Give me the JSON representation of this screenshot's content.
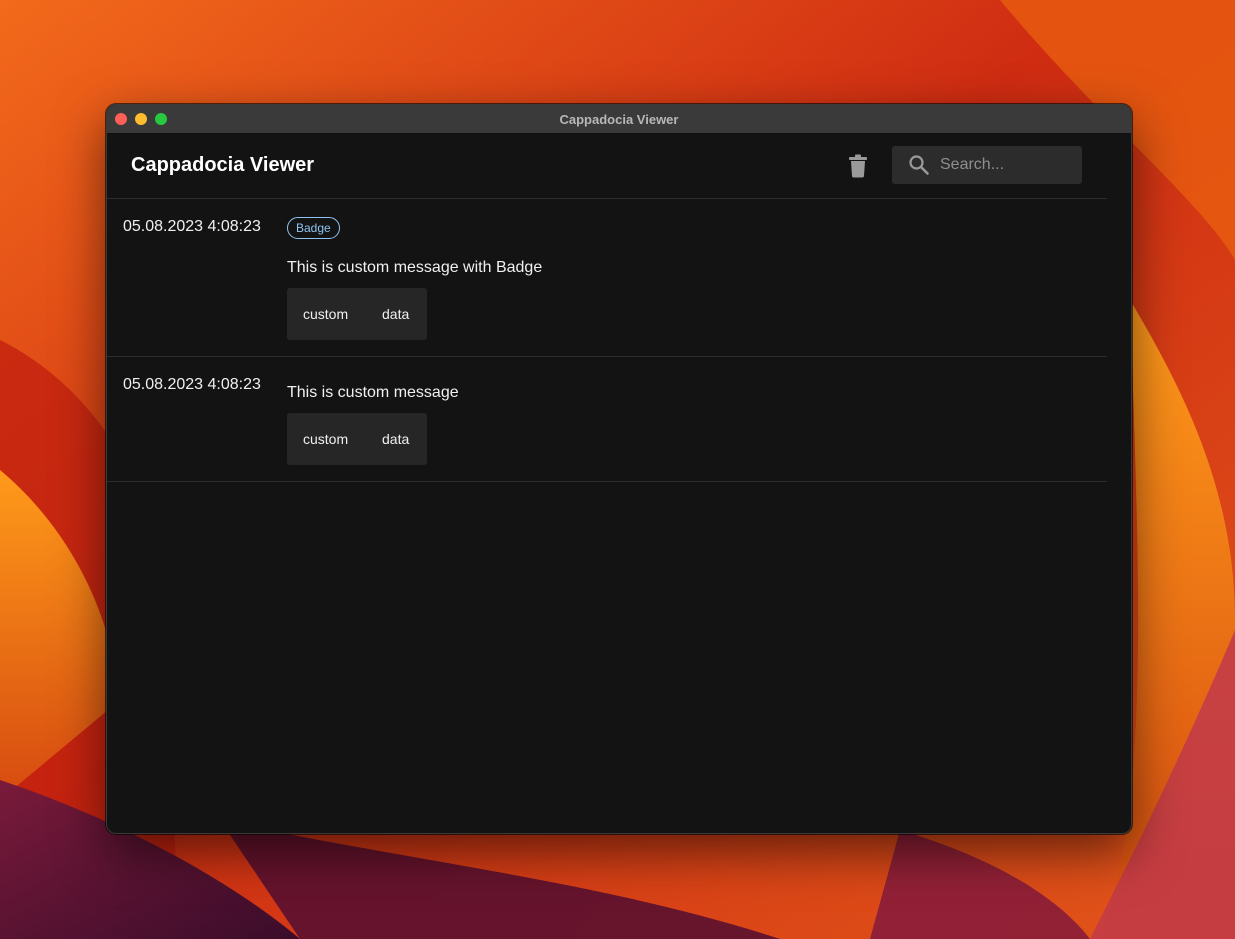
{
  "window": {
    "title": "Cappadocia Viewer"
  },
  "appbar": {
    "title": "Cappadocia Viewer",
    "clear_icon": "trash-icon",
    "search": {
      "icon": "search-icon",
      "placeholder": "Search...",
      "value": ""
    }
  },
  "logs": [
    {
      "timestamp": "05.08.2023 4:08:23",
      "badge": "Badge",
      "message": "This is custom message with Badge",
      "data": {
        "key": "custom",
        "value": "data"
      }
    },
    {
      "timestamp": "05.08.2023 4:08:23",
      "message": "This is custom message",
      "data": {
        "key": "custom",
        "value": "data"
      }
    }
  ],
  "colors": {
    "window_bg": "#131313",
    "titlebar_bg": "#3a3a3a",
    "badge": "#8ec3f0",
    "data_box": "#262626",
    "search_bg": "#2c2c2c"
  }
}
